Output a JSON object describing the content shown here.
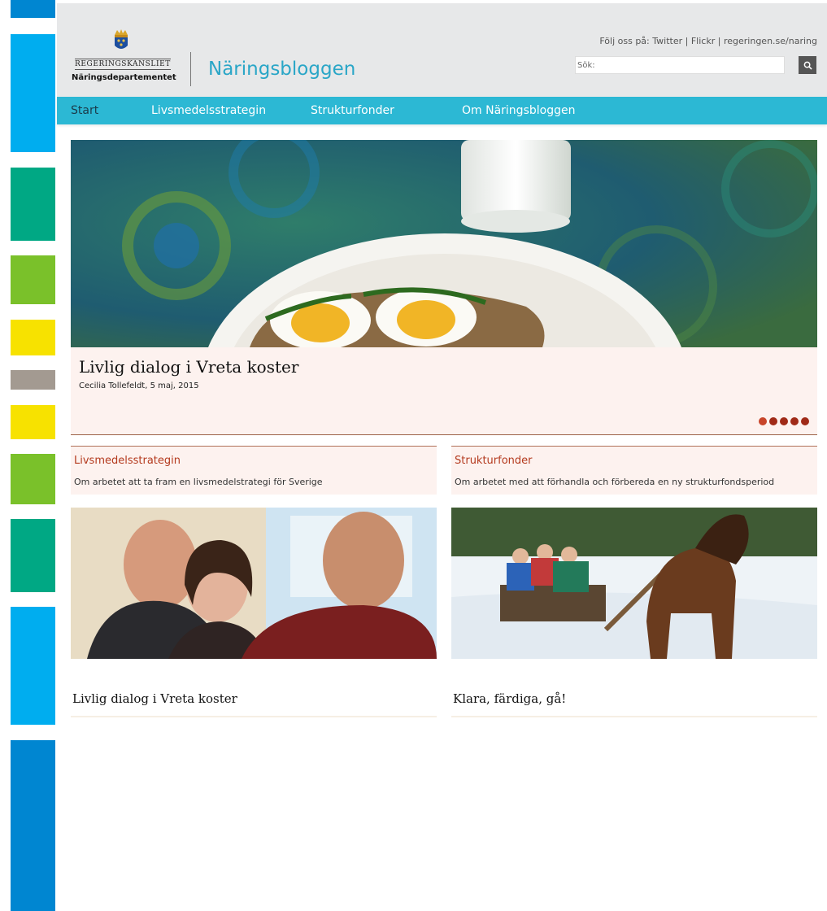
{
  "colors": {
    "stripes": [
      "#0086d1",
      "#00adef",
      "#00a884",
      "#7ac12a",
      "#f7e200",
      "#a39a91",
      "#f7e200",
      "#7ac12a",
      "#00a884",
      "#00adef",
      "#0086d1"
    ],
    "nav_bg": "#2cb8d4",
    "accent": "#b43a1e"
  },
  "header": {
    "logo_top": "REGERINGSKANSLIET",
    "logo_bottom": "Näringsdepartementet",
    "blog_title": "Näringsbloggen",
    "follow": {
      "prefix": "Följ oss på:",
      "links": [
        "Twitter",
        "Flickr",
        "regeringen.se/naring"
      ],
      "separator": "|"
    },
    "search": {
      "placeholder": "Sök:",
      "icon": "search-icon"
    }
  },
  "nav": {
    "items": [
      {
        "label": "Start",
        "active": true
      },
      {
        "label": "Livsmedelsstrategin",
        "active": false
      },
      {
        "label": "Strukturfonder",
        "active": false
      },
      {
        "label": "Om Näringsbloggen",
        "active": false
      }
    ]
  },
  "hero": {
    "title": "Livlig dialog i Vreta koster",
    "meta": "Cecilia Tollefeldt, 5 maj, 2015",
    "slide_count": 5,
    "active_slide": 1
  },
  "cards": [
    {
      "title": "Livsmedelsstrategin",
      "description": "Om arbetet att ta fram en livsmedelstrategi för Sverige",
      "caption": "Livlig dialog i Vreta koster"
    },
    {
      "title": "Strukturfonder",
      "description": "Om arbetet med att förhandla och förbereda en ny strukturfondsperiod",
      "caption": "Klara, färdiga, gå!"
    }
  ]
}
